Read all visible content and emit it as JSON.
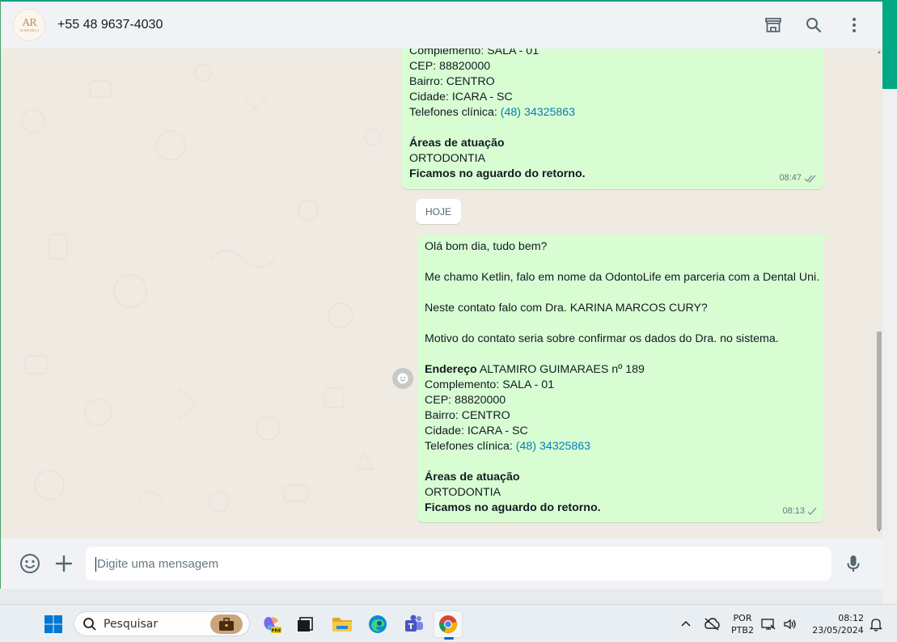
{
  "header": {
    "avatar_line1": "AR",
    "avatar_line2": "ALINE RICCI",
    "contact_name": "+55 48 9637-4030",
    "icons": [
      "catalog-icon",
      "search-icon",
      "menu-icon"
    ]
  },
  "messages": [
    {
      "lines": [
        {
          "text": "Complemento: SALA - 01"
        },
        {
          "text": "CEP: 88820000"
        },
        {
          "text": "Bairro: CENTRO"
        },
        {
          "text": "Cidade: ICARA - SC"
        },
        {
          "label": "Telefones clínica: ",
          "link": "(48) 34325863"
        },
        {
          "text": ""
        },
        {
          "bold": "Áreas de atuação"
        },
        {
          "text": "ORTODONTIA"
        },
        {
          "bold": "Ficamos no aguardo do retorno."
        }
      ],
      "time": "08:47",
      "status": "read"
    },
    {
      "lines": [
        {
          "text": "Olá bom dia, tudo bem?"
        },
        {
          "text": ""
        },
        {
          "text": "Me chamo Ketlin, falo em nome da OdontoLife em parceria com a Dental Uni."
        },
        {
          "text": ""
        },
        {
          "text": "Neste contato falo com Dra. KARINA MARCOS CURY?"
        },
        {
          "text": ""
        },
        {
          "text": "Motivo do contato seria sobre confirmar os dados do Dra. no sistema."
        },
        {
          "text": ""
        },
        {
          "bold": "Endereço",
          "text": " ALTAMIRO GUIMARAES nº 189"
        },
        {
          "text": "Complemento: SALA - 01"
        },
        {
          "text": "CEP: 88820000"
        },
        {
          "text": "Bairro: CENTRO"
        },
        {
          "text": "Cidade: ICARA - SC"
        },
        {
          "label": "Telefones clínica: ",
          "link": "(48) 34325863"
        },
        {
          "text": ""
        },
        {
          "bold": "Áreas de atuação"
        },
        {
          "text": "ORTODONTIA"
        },
        {
          "bold": "Ficamos no aguardo do retorno."
        }
      ],
      "time": "08:13",
      "status": "sent"
    }
  ],
  "date_divider": "HOJE",
  "composer": {
    "placeholder": "Digite uma mensagem"
  },
  "taskbar": {
    "search_placeholder": "Pesquisar",
    "lang_line1": "POR",
    "lang_line2": "PTB2",
    "time": "08:12",
    "date": "23/05/2024"
  },
  "colors": {
    "accent": "#00a884",
    "bubble_out": "#d9fdd3",
    "chat_bg": "#efeae2",
    "link": "#027eb5"
  }
}
